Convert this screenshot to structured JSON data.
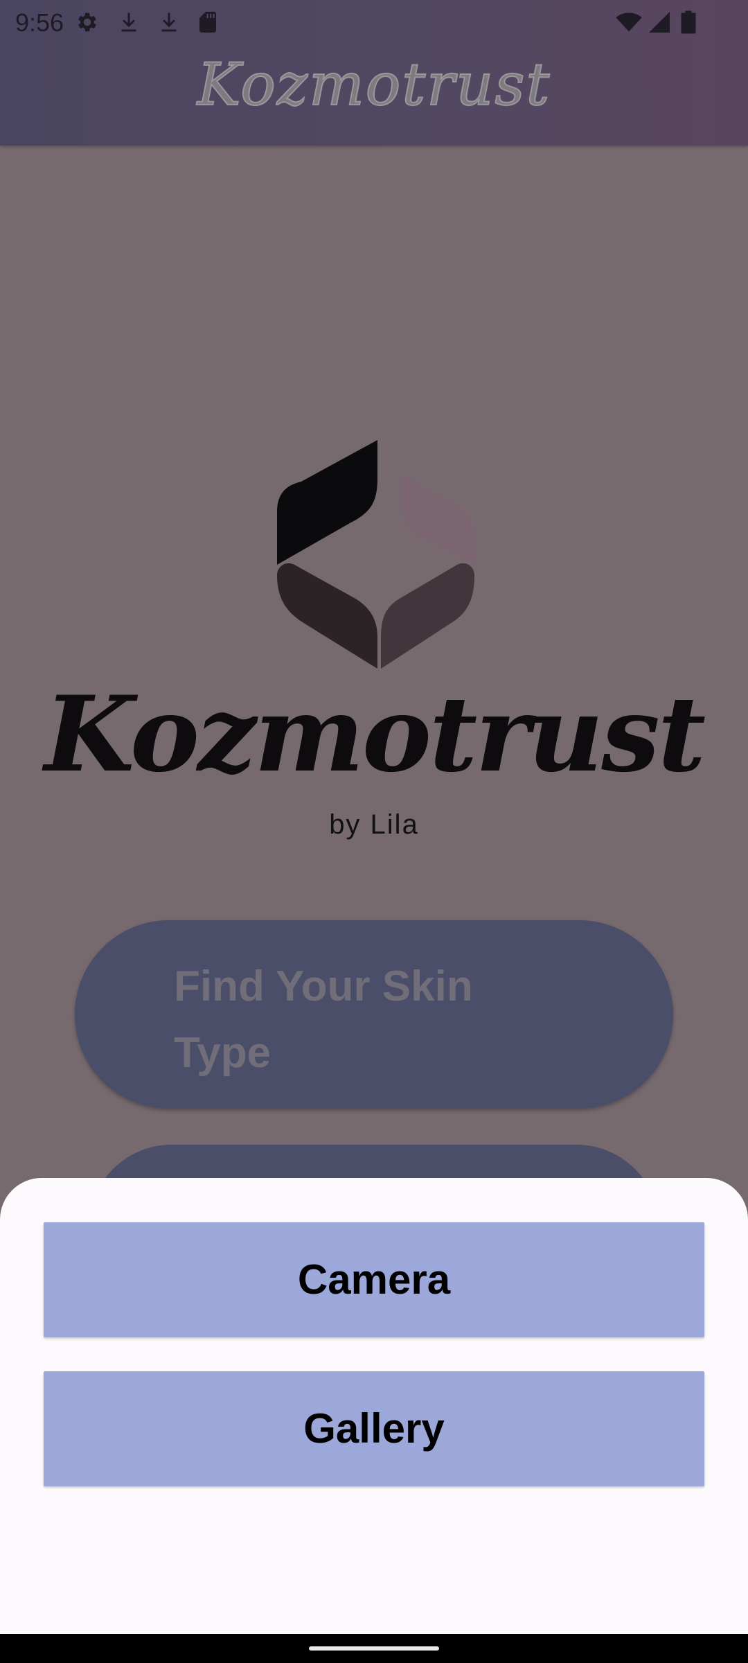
{
  "status_bar": {
    "time": "9:56",
    "left_icons": [
      "gear-icon",
      "download-icon",
      "download-icon",
      "sd-card-icon"
    ],
    "right_icons": [
      "wifi-icon",
      "signal-icon",
      "battery-icon"
    ]
  },
  "app_bar": {
    "title": "Kozmotrust"
  },
  "brand": {
    "name": "Kozmotrust",
    "byline": "by Lila"
  },
  "main": {
    "skin_type_button_label": "Find Your Skin Type"
  },
  "bottom_sheet": {
    "camera_label": "Camera",
    "gallery_label": "Gallery"
  },
  "colors": {
    "scrim": "#766A6F",
    "app_bar": "#4A4560",
    "button_dimmed": "#4A4E68",
    "sheet_background": "#FCFAFD",
    "sheet_button": "#9DA8DA"
  }
}
